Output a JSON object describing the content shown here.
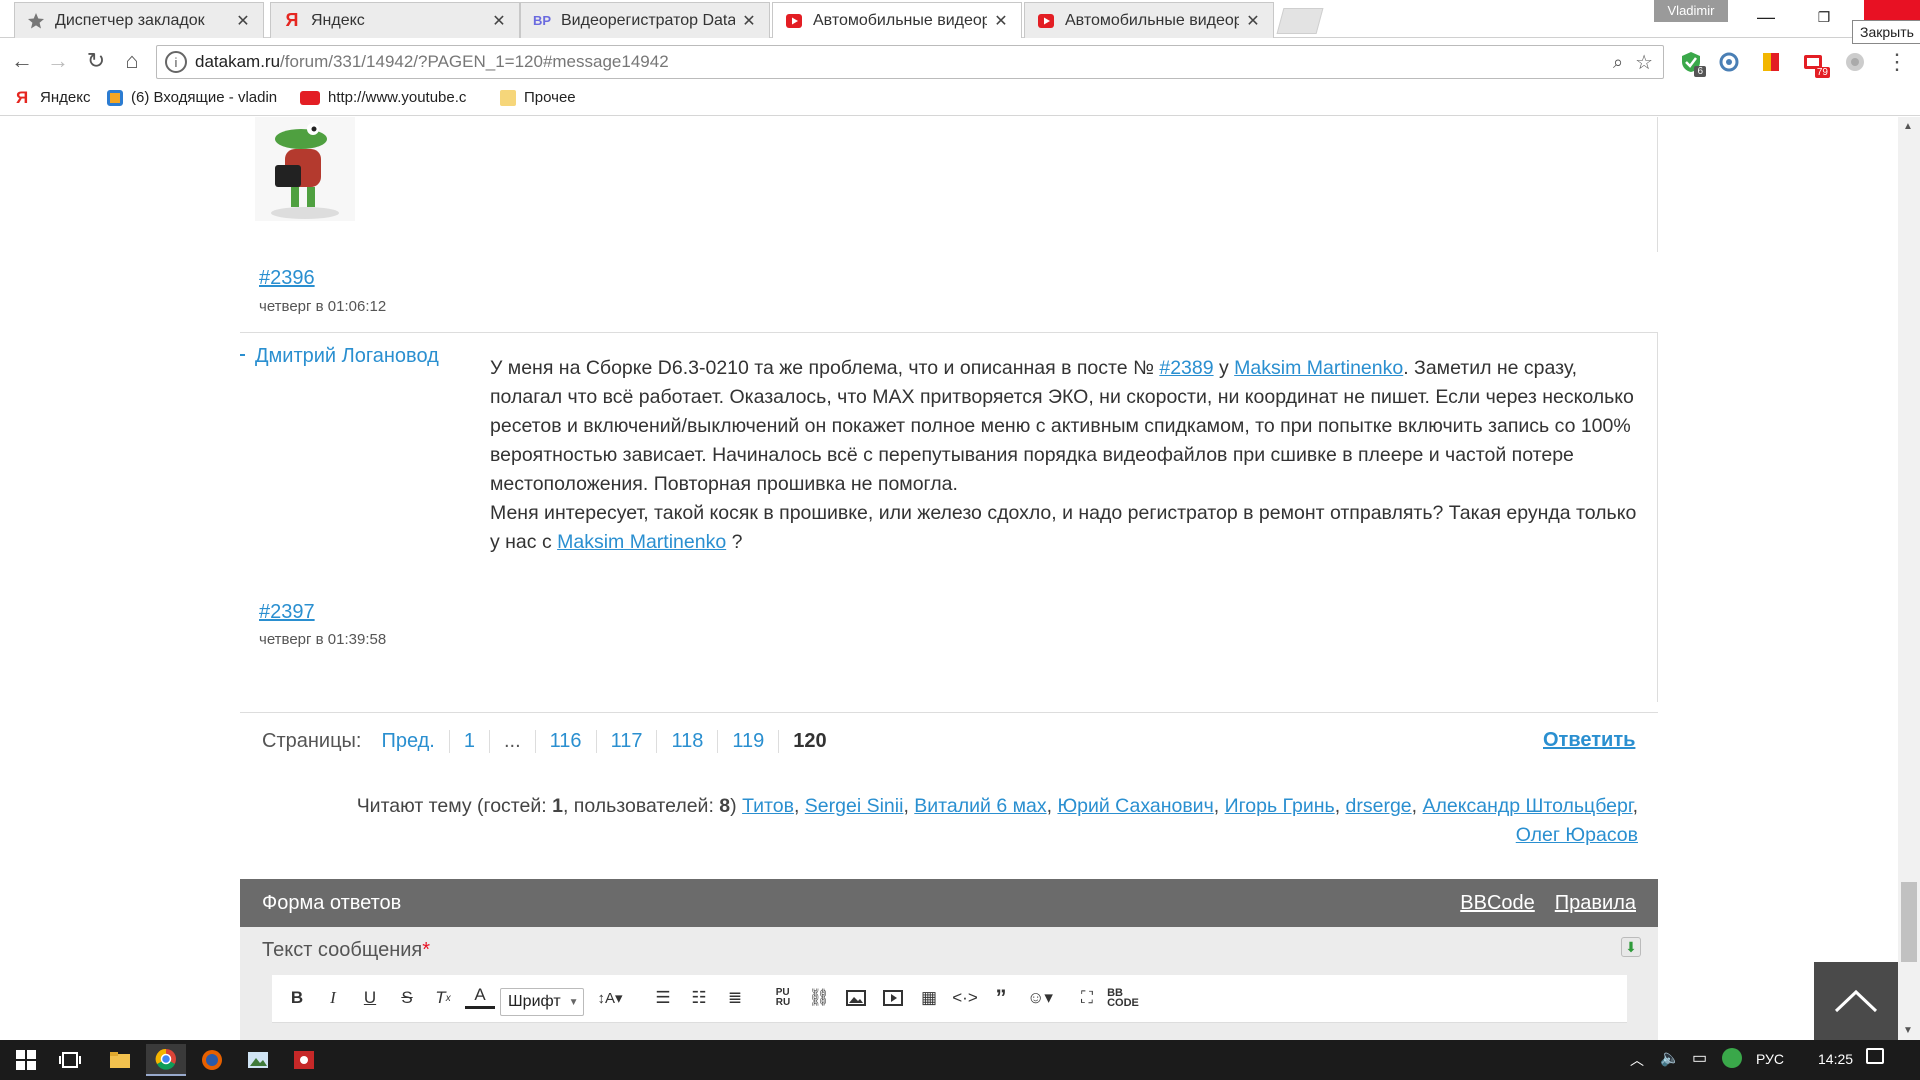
{
  "browser": {
    "tabs": [
      {
        "label": "Диспетчер закладок",
        "icon": "star-icon"
      },
      {
        "label": "Яндекс",
        "icon": "yandex-icon"
      },
      {
        "label": "Видеорегистратор Datal",
        "icon": "vr-icon"
      },
      {
        "label": "Автомобильные видеор",
        "icon": "play-icon"
      },
      {
        "label": "Автомобильные видеор",
        "icon": "play-icon"
      }
    ],
    "user_badge": "Vladimir",
    "close_tooltip": "Закрыть",
    "url_host": "datakam.ru",
    "url_rest": "/forum/331/14942/?PAGEN_1=120#message14942",
    "ext_badges": {
      "shield": "6",
      "mail": "79"
    },
    "bookmarks": [
      {
        "label": "Яндекс"
      },
      {
        "label": "(6) Входящие - vladin"
      },
      {
        "label": "http://www.youtube.c"
      },
      {
        "label": "Прочее"
      }
    ]
  },
  "forum": {
    "post_prev": {
      "num": "#2396",
      "time": "четверг в 01:06:12"
    },
    "post": {
      "author": "Дмитрий Логановод",
      "p1_a": "У меня на Сборке D6.3-0210 та же проблема, что и описанная в посте № ",
      "p1_link1": "#2389",
      "p1_b": " у ",
      "p1_link2": "Maksim Martinenko",
      "p1_c": ". Заметил не сразу, полагал что всё работает. Оказалось, что MAX притворяется ЭКО, ни скорости, ни координат не пишет. Если через несколько ресетов и включений/выключений он покажет полное меню с активным спидкамом, то при попытке включить запись со 100% вероятностью зависает. Начиналось всё с перепутывания порядка видеофайлов при сшивке в плеере и частой потере местоположения. Повторная прошивка не помогла.",
      "p2_a": "Меня интересует, такой косяк в прошивке, или железо сдохло, и надо регистратор в ремонт отправлять? Такая ерунда только у нас с ",
      "p2_link": "Maksim Martinenko",
      "p2_b": " ?",
      "num": "#2397",
      "time": "четверг в 01:39:58"
    },
    "pagination": {
      "label": "Страницы:",
      "prev": "Пред.",
      "first": "1",
      "ellipsis": "...",
      "pages": [
        "116",
        "117",
        "118",
        "119"
      ],
      "current": "120",
      "reply": "Ответить"
    },
    "readers": {
      "prefix": "Читают тему (гостей: ",
      "guests": "1",
      "mid": ", пользователей: ",
      "users": "8",
      "suffix": ") ",
      "names": [
        "Титов",
        "Sergei Sinii",
        "Виталий 6 мах",
        "Юрий Саханович",
        "Игорь Гринь",
        "drserge",
        "Александр Штольцберг",
        "Олег Юрасов"
      ]
    },
    "reply_form": {
      "title": "Форма ответов",
      "bbcode": "BBCode",
      "rules": "Правила",
      "field_label": "Текст сообщения",
      "required_mark": "*",
      "font_select": "Шрифт"
    }
  },
  "taskbar": {
    "lang": "РУС",
    "time": "14:25"
  },
  "colors": {
    "link": "#2a8fd0",
    "form_header": "#6b6b6b",
    "accent_red": "#e81123"
  }
}
